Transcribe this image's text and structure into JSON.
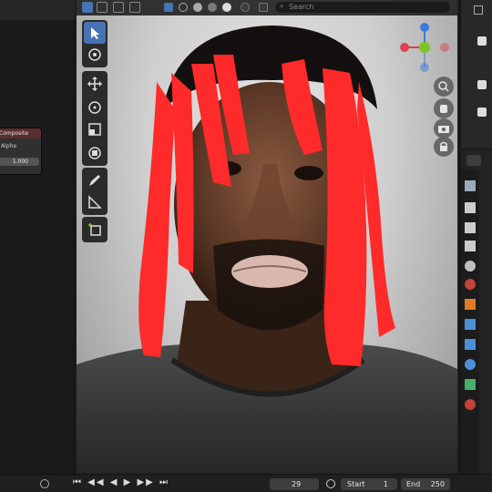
{
  "compositor": {
    "node_title": "Composite",
    "node_socket": "Alpha",
    "node_value": "1.000"
  },
  "viewport_header": {
    "search_placeholder": "Search"
  },
  "gizmo": {
    "y_label": "Y",
    "x_label": "X",
    "z_label": "Z"
  },
  "toolbar": {
    "tools": [
      "select",
      "cursor",
      "move",
      "rotate",
      "scale",
      "transform",
      "annotate",
      "measure",
      "add-cube"
    ]
  },
  "timeline": {
    "current_frame": "29",
    "start_label": "Start",
    "start_value": "1",
    "end_label": "End",
    "end_value": "250"
  },
  "colors": {
    "accent": "#4772b3",
    "hair_red": "#ff2a2a",
    "axis_x": "#e04050",
    "axis_y": "#7cc624",
    "axis_z": "#3d7ad8"
  }
}
